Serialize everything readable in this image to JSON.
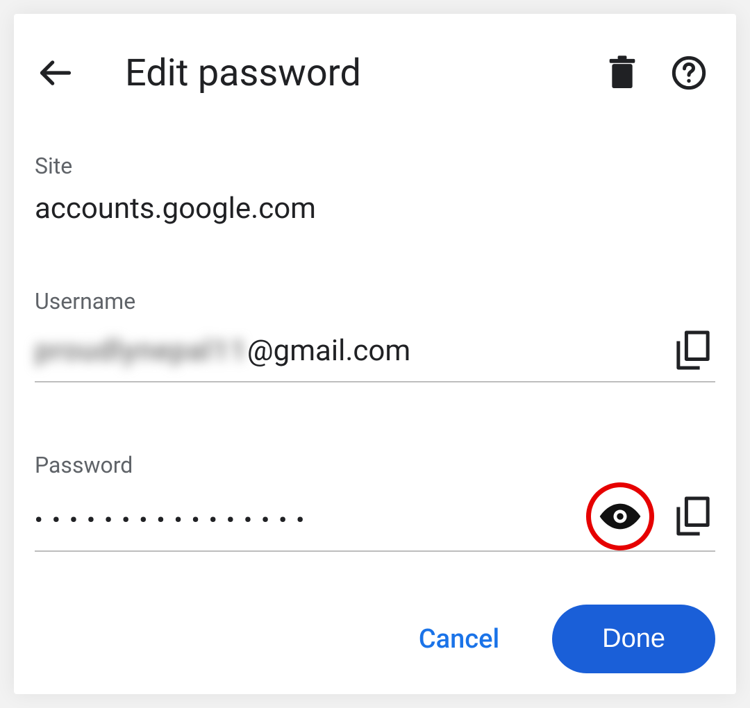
{
  "header": {
    "title": "Edit password"
  },
  "site": {
    "label": "Site",
    "value": "accounts.google.com"
  },
  "username": {
    "label": "Username",
    "value_redacted_prefix": "proudlynepal11",
    "value_suffix": "@gmail.com"
  },
  "password": {
    "label": "Password",
    "masked": "••••••••••••••••"
  },
  "footer": {
    "cancel": "Cancel",
    "done": "Done"
  },
  "icons": {
    "back": "back-arrow",
    "delete": "trash",
    "help": "help-circle",
    "copy": "copy",
    "eye": "eye"
  },
  "highlight": {
    "eye_button_circled": true
  }
}
